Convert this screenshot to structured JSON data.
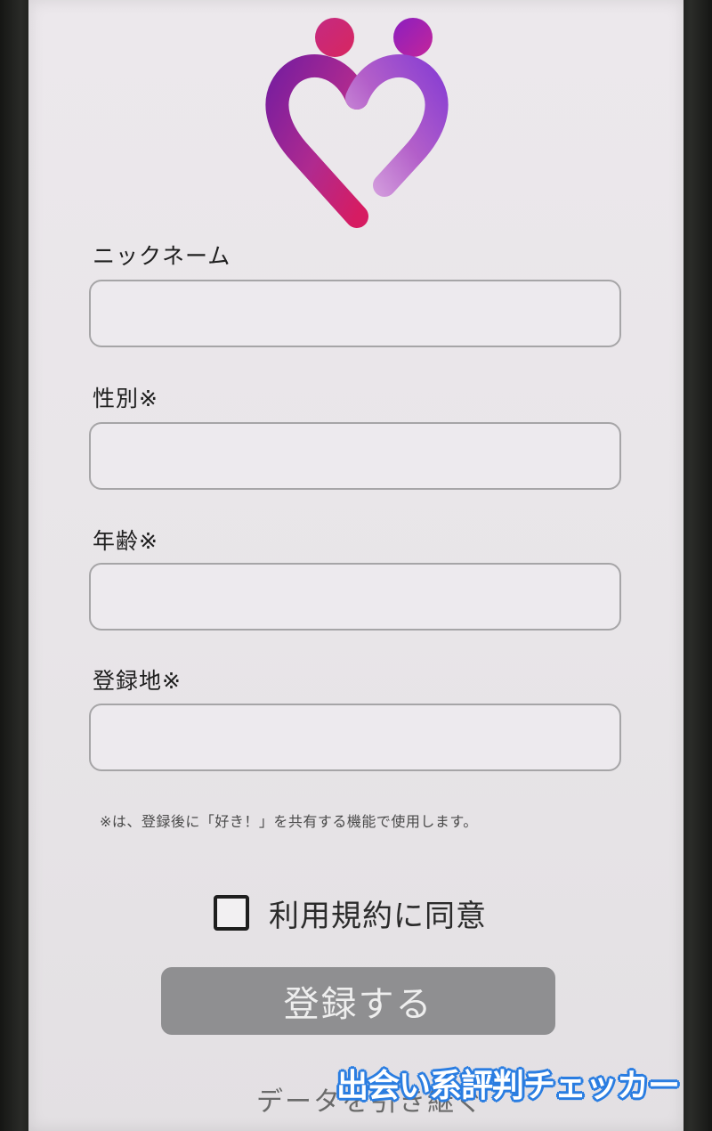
{
  "app": {
    "logo_icon": "couple-heart-logo-icon",
    "brand_gradient": [
      "#6a1fa8",
      "#a02f9c",
      "#d21c6a"
    ]
  },
  "form": {
    "fields": [
      {
        "label": "ニックネーム",
        "value": "",
        "placeholder": ""
      },
      {
        "label": "性別※",
        "value": "",
        "placeholder": ""
      },
      {
        "label": "年齢※",
        "value": "",
        "placeholder": ""
      },
      {
        "label": "登録地※",
        "value": "",
        "placeholder": ""
      }
    ],
    "note": "※は、登録後に「好き！」を共有する機能で使用します。",
    "agree_label": "利用規約に同意",
    "agree_checked": false,
    "submit_label": "登録する",
    "submit_color": "#8f8f91",
    "bottom_link": "データを引き継ぐ"
  },
  "watermark": {
    "text": "出会い系評判チェッカー",
    "color": "#2a7de1"
  }
}
